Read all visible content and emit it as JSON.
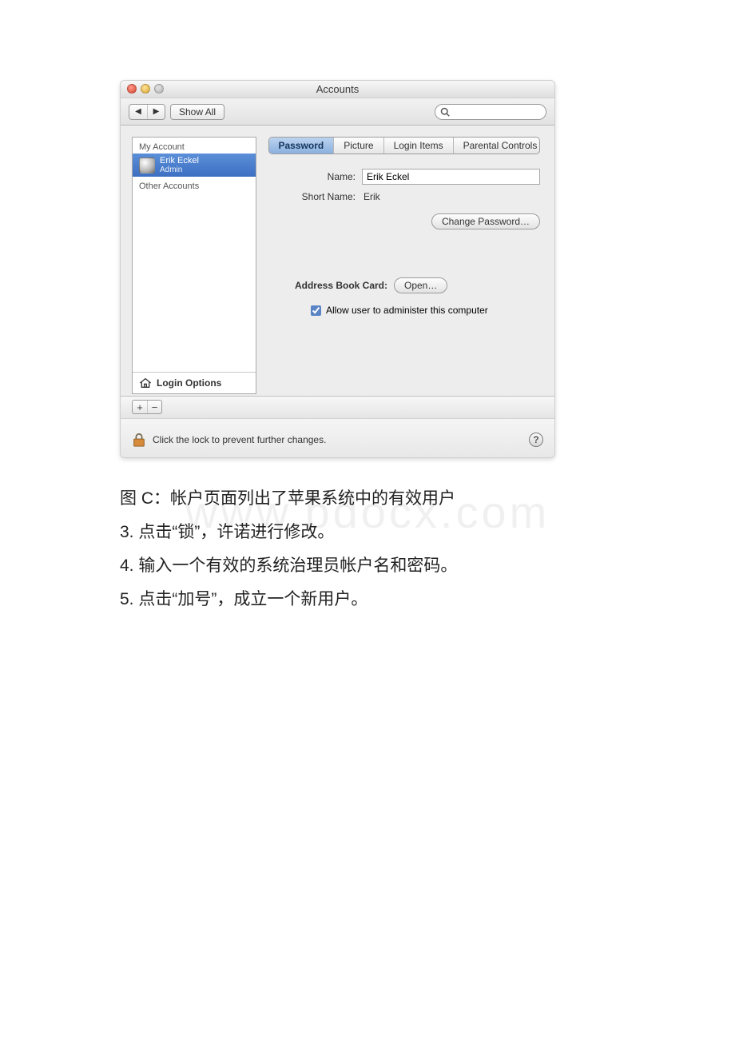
{
  "window": {
    "title": "Accounts",
    "toolbar": {
      "show_all_label": "Show All",
      "search_placeholder": ""
    }
  },
  "sidebar": {
    "section_my_account": "My Account",
    "section_other_accounts": "Other Accounts",
    "selected_user": {
      "name": "Erik Eckel",
      "role": "Admin"
    },
    "login_options_label": "Login Options"
  },
  "tabs": {
    "password": "Password",
    "picture": "Picture",
    "login_items": "Login Items",
    "parental_controls": "Parental Controls",
    "active": "password"
  },
  "form": {
    "name_label": "Name:",
    "name_value": "Erik Eckel",
    "short_name_label": "Short Name:",
    "short_name_value": "Erik",
    "change_password_label": "Change Password…",
    "address_book_label": "Address Book Card:",
    "open_label": "Open…",
    "allow_admin_label": "Allow user to administer this computer",
    "allow_admin_checked": true
  },
  "footer": {
    "lock_text": "Click the lock to prevent further changes."
  },
  "captions": {
    "c1": "图 C：帐户页面列出了苹果系统中的有效用户",
    "c2": "3. 点击“锁”，许诺进行修改。",
    "c3": "4. 输入一个有效的系统治理员帐户名和密码。",
    "c4": "5. 点击“加号”，成立一个新用户。"
  },
  "watermark": "www.bdocx.com"
}
